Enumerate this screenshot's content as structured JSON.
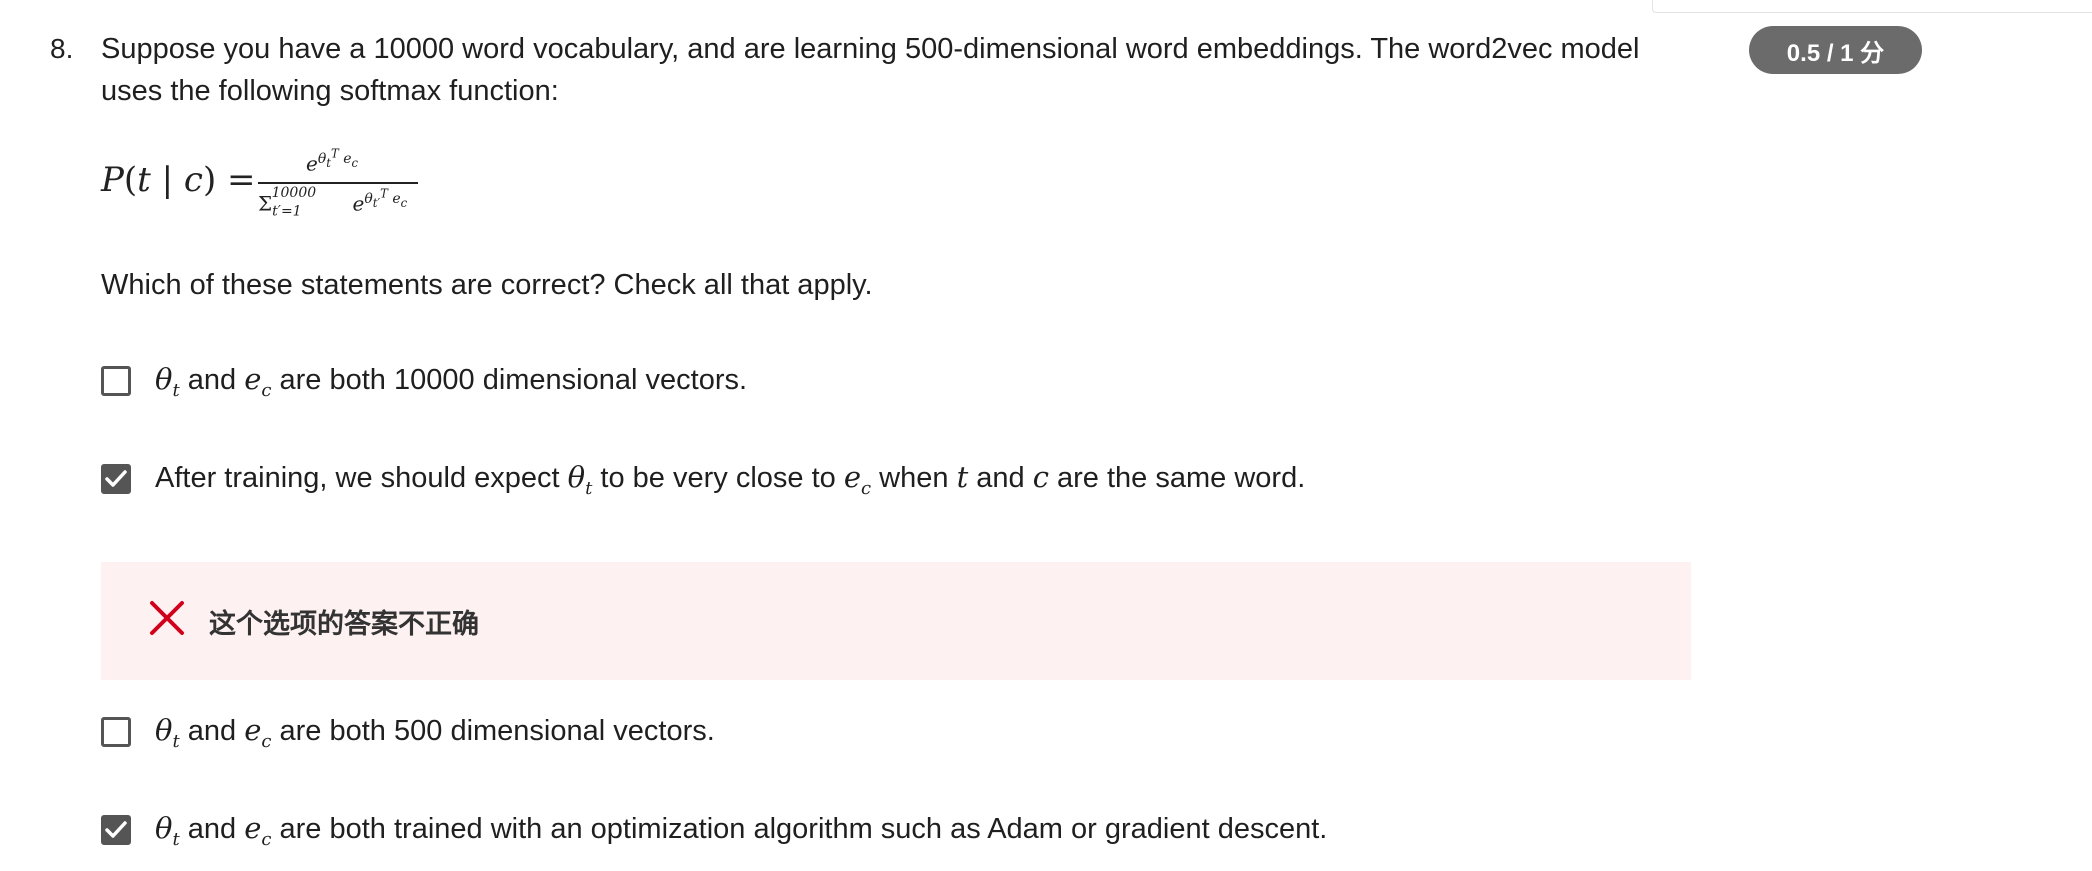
{
  "question": {
    "number": "8.",
    "prompt": "Suppose you have a 10000 word vocabulary, and are learning 500-dimensional word embeddings. The word2vec model uses the following softmax function:",
    "instruction": "Which of these statements are correct? Check all that apply.",
    "score": "0.5 / 1 分"
  },
  "formula": {
    "lhs": "P(t | c) =",
    "numerator": "e^{θ_t^T e_c}",
    "denominator": "Σ_{t'=1}^{10000} e^{θ_t'^T e_c}"
  },
  "options": [
    {
      "text": "and e_c are both 10000 dimensional vectors.",
      "parts": [
        "θ",
        "t",
        " and ",
        "e",
        "c",
        " are both 10000 dimensional vectors."
      ],
      "checked": false
    },
    {
      "text": "After training, we should expect θ_t to be very close to e_c when t and c are the same word.",
      "checked": true
    },
    {
      "text": "and e_c are both 500 dimensional vectors.",
      "parts": [
        "θ",
        "t",
        " and ",
        "e",
        "c",
        " are both 500 dimensional vectors."
      ],
      "checked": false
    },
    {
      "text": "and e_c are both trained with an optimization algorithm such as Adam or gradient descent.",
      "parts": [
        "θ",
        "t",
        " and ",
        "e",
        "c",
        " are both trained with an optimization algorithm such as Adam or gradient descent."
      ],
      "checked": true
    }
  ],
  "option_texts": {
    "o1_tail": " are both 10000 dimensional vectors.",
    "o2_a": "After training, we should expect ",
    "o2_b": " to be very close to ",
    "o2_c": " when ",
    "o2_d": " and ",
    "o2_e": " are the same word.",
    "o3_tail": " are both 500 dimensional vectors.",
    "o4_tail": " are both trained with an optimization algorithm such as Adam or gradient descent.",
    "and": " and "
  },
  "feedback": {
    "text": "这个选项的答案不正确",
    "icon": "x-icon",
    "color": "#d0021b"
  },
  "colors": {
    "badge": "#6b6b6b",
    "feedback_bg": "#fdf1f1",
    "checkbox": "#555555"
  }
}
